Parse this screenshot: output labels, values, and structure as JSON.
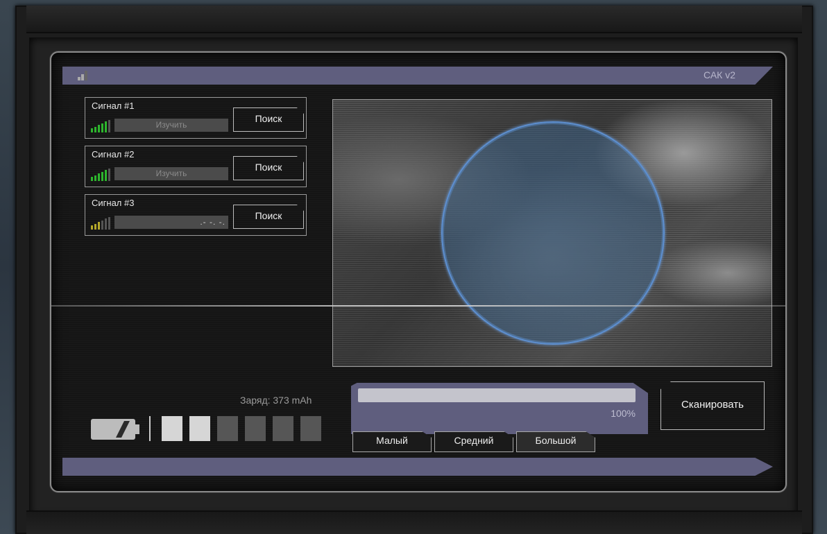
{
  "app": {
    "title": "САК v2"
  },
  "signals": [
    {
      "label": "Сигнал #1",
      "study_text": "Изучить",
      "search_label": "Поиск",
      "strength": 5,
      "bar_color": "#2db52d"
    },
    {
      "label": "Сигнал #2",
      "study_text": "Изучить",
      "search_label": "Поиск",
      "strength": 5,
      "bar_color": "#2db52d"
    },
    {
      "label": "Сигнал #3",
      "study_text": ".- -. -.",
      "search_label": "Поиск",
      "strength": 3,
      "bar_color": "#b5a82a"
    }
  ],
  "battery": {
    "charge_label": "Заряд: 373 mAh",
    "cells_total": 6,
    "cells_on": 2
  },
  "progress": {
    "value_percent": 100,
    "label": "100%"
  },
  "sizes": [
    {
      "label": "Малый"
    },
    {
      "label": "Средний"
    },
    {
      "label": "Большой"
    }
  ],
  "selected_size": "Большой",
  "actions": {
    "scan_label": "Сканировать"
  },
  "colors": {
    "panel_accent": "#5f5e7e",
    "scan_circle": "#5d8fd0"
  }
}
